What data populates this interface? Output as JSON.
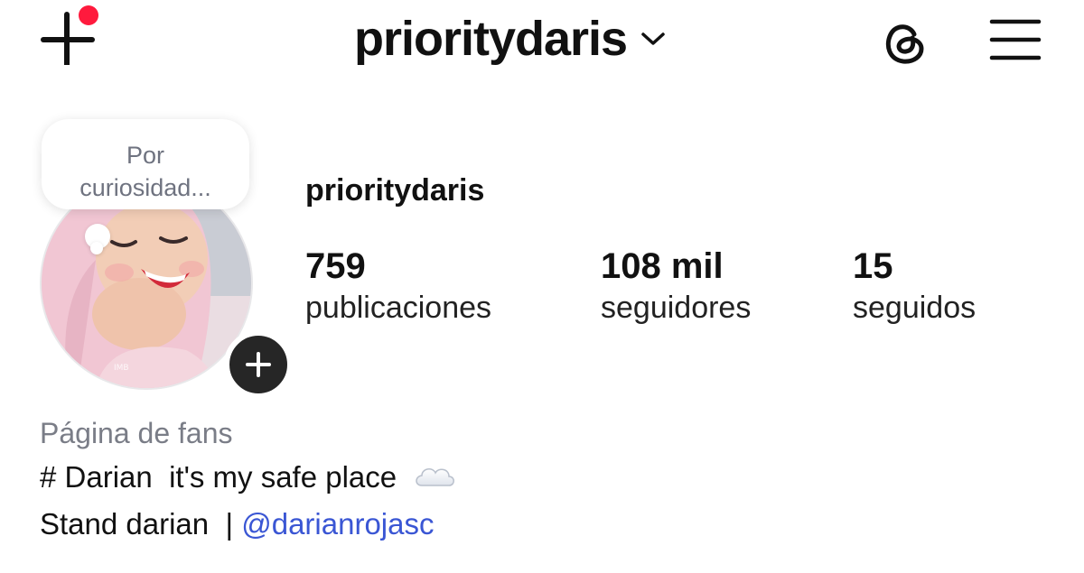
{
  "header": {
    "username": "prioritydaris",
    "icons": {
      "create": "plus-icon",
      "dropdown": "chevron-down-icon",
      "threads": "threads-icon",
      "menu": "hamburger-menu-icon"
    },
    "notification_color": "#ff1a3d"
  },
  "note": {
    "text_line1": "Por",
    "text_line2": "curiosidad..."
  },
  "profile": {
    "name": "prioritydaris",
    "stats": [
      {
        "value": "759",
        "label": "publicaciones"
      },
      {
        "value": "108 mil",
        "label": "seguidores"
      },
      {
        "value": "15",
        "label": "seguidos"
      }
    ],
    "add_story_icon": "plus-icon"
  },
  "bio": {
    "category": "Página de fans",
    "line1_hash": "#",
    "line1_text": "Darian  it's my safe place",
    "line1_emoji_icon": "cloud-icon",
    "line2_text": "Stand darian  | ",
    "line2_mention": "@darianrojasc",
    "mention_color": "#3a56d4"
  }
}
